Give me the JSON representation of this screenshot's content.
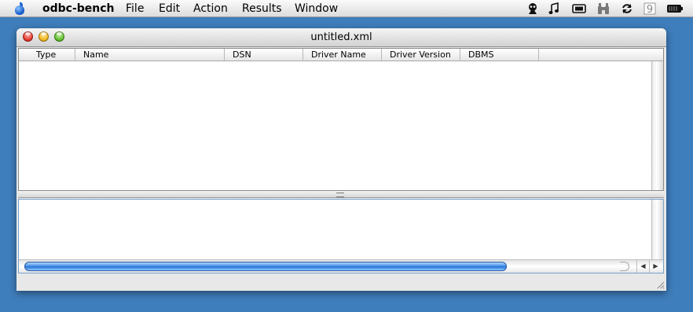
{
  "menubar": {
    "app_name": "odbc-bench",
    "items": [
      "File",
      "Edit",
      "Action",
      "Results",
      "Window"
    ],
    "apple_icon": "apple-logo-icon",
    "tray_icons": [
      "alien-icon",
      "music-note-icon",
      "display-icon",
      "binoculars-icon",
      "sync-icon",
      "calendar-icon",
      "battery-icon"
    ],
    "tray_calendar_text": "9"
  },
  "window": {
    "title": "untitled.xml",
    "columns": [
      "Type",
      "Name",
      "DSN",
      "Driver Name",
      "Driver Version",
      "DBMS"
    ],
    "rows": [],
    "horizontal_scroll_position": 0,
    "horizontal_scroll_visible_fraction": 0.81
  },
  "colors": {
    "desktop": "#3f7ebc",
    "scroll_thumb": "#2a76d8",
    "close": "#e2322a",
    "minimize": "#f0b21a",
    "zoom": "#5cbb2a"
  }
}
